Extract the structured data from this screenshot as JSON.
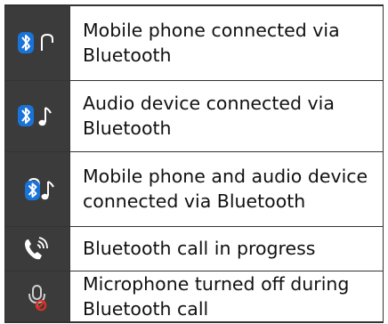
{
  "rows": [
    {
      "icon": "bluetooth-phone-icon",
      "description": "Mobile phone connected via Bluetooth"
    },
    {
      "icon": "bluetooth-audio-icon",
      "description": "Audio device connected via Bluetooth"
    },
    {
      "icon": "bluetooth-phone-audio-icon",
      "description": "Mobile phone and audio device connected via Bluetooth"
    },
    {
      "icon": "bluetooth-call-icon",
      "description": "Bluetooth call in progress"
    },
    {
      "icon": "microphone-off-icon",
      "description": "Microphone turned off during Bluetooth call"
    }
  ],
  "colors": {
    "icon_background": "#3b3b3b",
    "bluetooth_blue": "#1a73d9",
    "icon_white": "#ffffff",
    "muted_red": "#d93025",
    "text": "#111111"
  }
}
